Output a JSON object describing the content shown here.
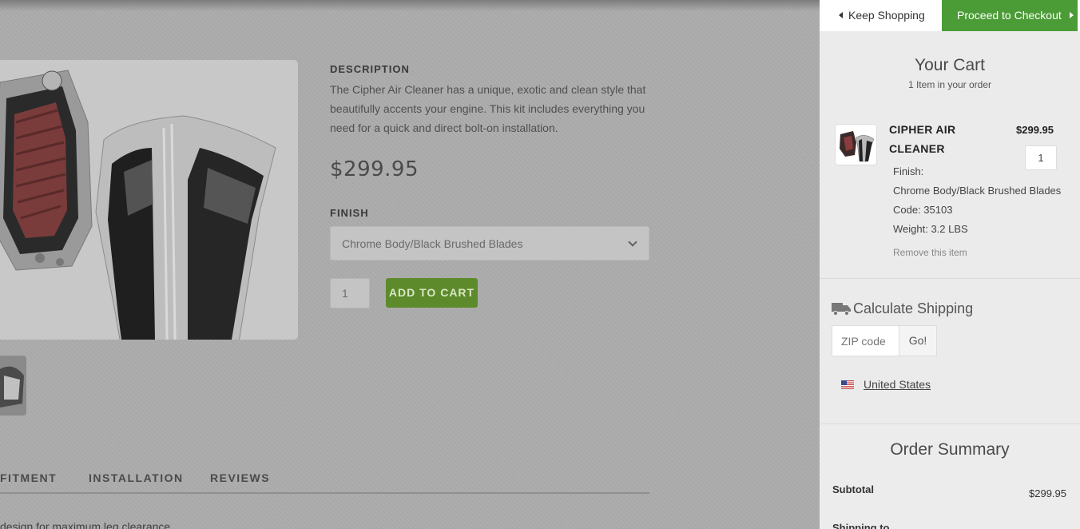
{
  "product": {
    "description_heading": "DESCRIPTION",
    "description_text": "The Cipher Air Cleaner has a unique, exotic and clean style that beautifully accents your engine. This kit includes everything you need for a quick and direct bolt-on installation.",
    "price": "$299.95",
    "finish_label": "FINISH",
    "finish_selected": "Chrome Body/Black Brushed Blades",
    "quantity": "1",
    "add_to_cart_label": "ADD TO CART",
    "tabs": [
      "FITMENT",
      "INSTALLATION",
      "REVIEWS"
    ],
    "feature_text": "design for maximum leg clearance"
  },
  "cart": {
    "keep_shopping_label": "Keep Shopping",
    "checkout_label": "Proceed to Checkout",
    "title": "Your Cart",
    "item_count": "1 Item in your order",
    "item": {
      "name": "CIPHER AIR CLEANER",
      "price": "$299.95",
      "quantity": "1",
      "finish_label": "Finish:",
      "finish_value": "Chrome Body/Black Brushed Blades",
      "code": "Code: 35103",
      "weight": "Weight: 3.2 LBS",
      "remove_label": "Remove this item"
    },
    "shipping": {
      "title": "Calculate Shipping",
      "zip_placeholder": "ZIP code",
      "go_label": "Go!",
      "country": "United States"
    },
    "summary": {
      "title": "Order Summary",
      "subtotal_label": "Subtotal",
      "subtotal_value": "$299.95",
      "shipping_label": "Shipping to"
    }
  },
  "colors": {
    "checkout_green": "#4b9b36",
    "add_to_cart_green": "#5d8a2a",
    "overlay_gray": "#ababab"
  }
}
